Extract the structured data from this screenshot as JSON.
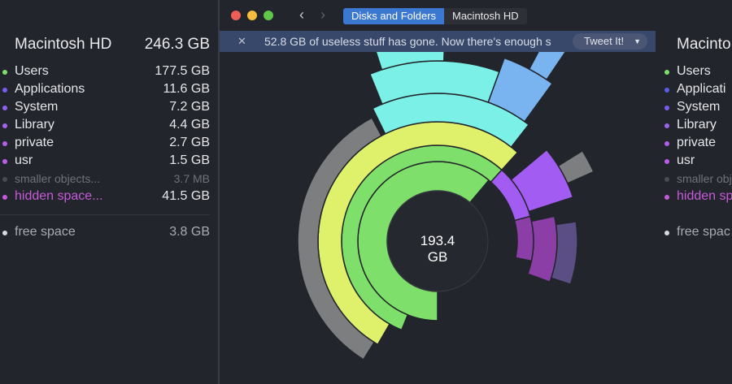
{
  "window": {
    "breadcrumb": [
      "Disks and Folders",
      "Macintosh HD"
    ],
    "banner": {
      "message": "52.8 GB of useless stuff has gone. Now there's enough s",
      "tweet_label": "Tweet It!"
    }
  },
  "sidebar": {
    "title": "Macintosh HD",
    "total": "246.3 GB",
    "items": [
      {
        "label": "Users",
        "size": "177.5 GB",
        "color": "#7ee06a"
      },
      {
        "label": "Applications",
        "size": "11.6 GB",
        "color": "#7a5cf0"
      },
      {
        "label": "System",
        "size": "7.2 GB",
        "color": "#8f63f2"
      },
      {
        "label": "Library",
        "size": "4.4 GB",
        "color": "#a565ee"
      },
      {
        "label": "private",
        "size": "2.7 GB",
        "color": "#b660ea"
      },
      {
        "label": "usr",
        "size": "1.5 GB",
        "color": "#bc5ee8"
      }
    ],
    "smaller": {
      "label": "smaller objects...",
      "size": "3.7  MB",
      "color": "#4a4c52"
    },
    "hidden": {
      "label": "hidden space...",
      "size": "41.5 GB",
      "color": "#c65ad8"
    },
    "free": {
      "label": "free space",
      "size": "3.8 GB",
      "color": "#d9dadd"
    }
  },
  "right_sidebar": {
    "title": "Macinto",
    "items": [
      "Users",
      "Applicati",
      "System",
      "Library",
      "private",
      "usr"
    ],
    "colors": [
      "#7ee06a",
      "#5b5ce8",
      "#7a5cf0",
      "#9b63ee",
      "#b05fea",
      "#bc5ee8"
    ],
    "smaller": "smaller obje",
    "hidden": "hidden spa",
    "free": "free spac"
  },
  "chart_center": {
    "value": "193.4",
    "unit": "GB"
  },
  "colors": {
    "close": "#ee5e56",
    "minimize": "#f4bd3e",
    "zoom": "#5fc64a",
    "users": "#7ee06a",
    "users_outer": "#dff06a",
    "cyan": "#7af0e6",
    "sky": "#7ab4f0",
    "violet": "#a35cf2",
    "purple": "#8a3ea6",
    "grey": "#7d7e80"
  }
}
